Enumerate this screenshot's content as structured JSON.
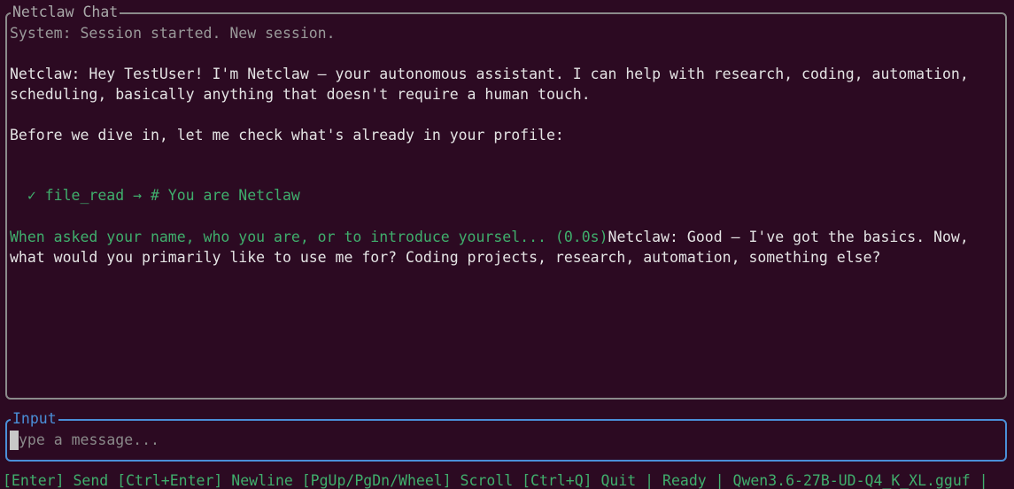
{
  "chat": {
    "title": "Netclaw Chat",
    "system_line": "System: Session started. New session.",
    "greeting_line1": "Netclaw: Hey TestUser! I'm Netclaw — your autonomous assistant. I can help with research, coding, automation,",
    "greeting_line2": "scheduling, basically anything that doesn't require a human touch.",
    "check_line": "Before we dive in, let me check what's already in your profile:",
    "tool_call": "  ✓ file_read → # You are Netclaw",
    "tool_result": "When asked your name, who you are, or to introduce yoursel... (0.0s)",
    "reply_line1": "Netclaw: Good — I've got the basics. Now,",
    "reply_line2": "what would you primarily like to use me for? Coding projects, research, automation, something else?"
  },
  "input": {
    "title": "Input",
    "placeholder": "ype a message..."
  },
  "status_bar": {
    "text": "[Enter] Send [Ctrl+Enter] Newline [PgUp/PgDn/Wheel] Scroll [Ctrl+Q] Quit | Ready | Qwen3.6-27B-UD-Q4_K_XL.gguf |"
  },
  "colors": {
    "background": "#2c0a22",
    "accent_green": "#3fae6c",
    "input_border": "#4a8fd8",
    "chat_border": "#8b8b8b"
  }
}
